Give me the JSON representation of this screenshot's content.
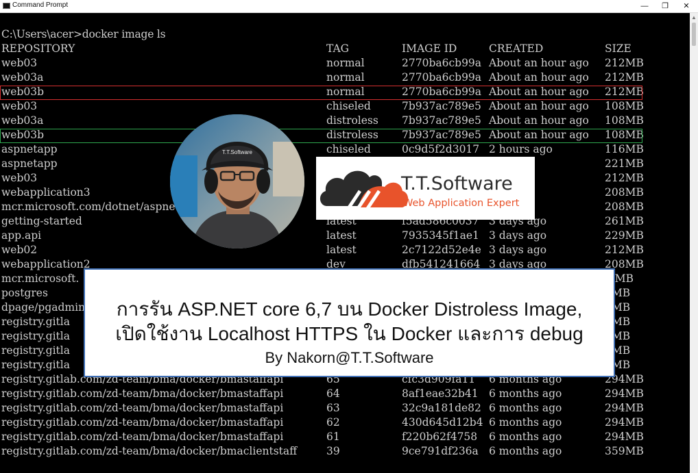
{
  "window": {
    "title": "Command Prompt",
    "minimize": "—",
    "maximize": "❐",
    "close": "✕"
  },
  "console": {
    "command_line": "C:\\Users\\acer>docker image ls",
    "headers": {
      "repository": "REPOSITORY",
      "tag": "TAG",
      "image_id": "IMAGE ID",
      "created": "CREATED",
      "size": "SIZE"
    },
    "rows": [
      {
        "repository": "web03",
        "tag": "normal",
        "image_id": "2770ba6cb99a",
        "created": "About an hour ago",
        "size": "212MB"
      },
      {
        "repository": "web03a",
        "tag": "normal",
        "image_id": "2770ba6cb99a",
        "created": "About an hour ago",
        "size": "212MB"
      },
      {
        "repository": "web03b",
        "tag": "normal",
        "image_id": "2770ba6cb99a",
        "created": "About an hour ago",
        "size": "212MB"
      },
      {
        "repository": "web03",
        "tag": "chiseled",
        "image_id": "7b937ac789e5",
        "created": "About an hour ago",
        "size": "108MB"
      },
      {
        "repository": "web03a",
        "tag": "distroless",
        "image_id": "7b937ac789e5",
        "created": "About an hour ago",
        "size": "108MB"
      },
      {
        "repository": "web03b",
        "tag": "distroless",
        "image_id": "7b937ac789e5",
        "created": "About an hour ago",
        "size": "108MB"
      },
      {
        "repository": "aspnetapp",
        "tag": "chiseled",
        "image_id": "0c9d5f2d3017",
        "created": "2 hours ago",
        "size": "116MB"
      },
      {
        "repository": "aspnetapp",
        "tag": "",
        "image_id": "",
        "created": "ago",
        "size": "221MB"
      },
      {
        "repository": "web03",
        "tag": "",
        "image_id": "",
        "created": "ago",
        "size": "212MB"
      },
      {
        "repository": "webapplication3",
        "tag": "",
        "image_id": "",
        "created": "ago",
        "size": "208MB"
      },
      {
        "repository": "mcr.microsoft.com/dotnet/aspne",
        "tag": "",
        "image_id": "",
        "created": "ago",
        "size": "208MB"
      },
      {
        "repository": "getting-started",
        "tag": "latest",
        "image_id": "f5ad586c0037",
        "created": "3 days ago",
        "size": "261MB"
      },
      {
        "repository": "app.api",
        "tag": "latest",
        "image_id": "7935345f1ae1",
        "created": "3 days ago",
        "size": "229MB"
      },
      {
        "repository": "web02",
        "tag": "latest",
        "image_id": "2c7122d52e4e",
        "created": "3 days ago",
        "size": "212MB"
      },
      {
        "repository": "webapplication2",
        "tag": "dev",
        "image_id": "dfb541241664",
        "created": "3 days ago",
        "size": "208MB"
      },
      {
        "repository": "mcr.microsoft.",
        "tag": "",
        "image_id": "",
        "created": "",
        "size": ".5MB"
      },
      {
        "repository": "postgres",
        "tag": "",
        "image_id": "",
        "created": "",
        "size": "9MB"
      },
      {
        "repository": "dpage/pgadmin4",
        "tag": "",
        "image_id": "",
        "created": "",
        "size": "0MB"
      },
      {
        "repository": "registry.gitla",
        "tag": "",
        "image_id": "",
        "created": "",
        "size": "2MB"
      },
      {
        "repository": "registry.gitla",
        "tag": "",
        "image_id": "",
        "created": "",
        "size": "4MB"
      },
      {
        "repository": "registry.gitla",
        "tag": "",
        "image_id": "",
        "created": "",
        "size": "4MB"
      },
      {
        "repository": "registry.gitla",
        "tag": "",
        "image_id": "",
        "created": "",
        "size": "4MB"
      },
      {
        "repository": "registry.gitlab.com/zd-team/bma/docker/bmastaffapi",
        "tag": "65",
        "image_id": "cfc3d909fa11",
        "created": "6 months ago",
        "size": "294MB"
      },
      {
        "repository": "registry.gitlab.com/zd-team/bma/docker/bmastaffapi",
        "tag": "64",
        "image_id": "8af1eae32b41",
        "created": "6 months ago",
        "size": "294MB"
      },
      {
        "repository": "registry.gitlab.com/zd-team/bma/docker/bmastaffapi",
        "tag": "63",
        "image_id": "32c9a181de82",
        "created": "6 months ago",
        "size": "294MB"
      },
      {
        "repository": "registry.gitlab.com/zd-team/bma/docker/bmastaffapi",
        "tag": "62",
        "image_id": "430d645d12b4",
        "created": "6 months ago",
        "size": "294MB"
      },
      {
        "repository": "registry.gitlab.com/zd-team/bma/docker/bmastaffapi",
        "tag": "61",
        "image_id": "f220b62f4758",
        "created": "6 months ago",
        "size": "294MB"
      },
      {
        "repository": "registry.gitlab.com/zd-team/bma/docker/bmaclientstaff",
        "tag": "39",
        "image_id": "9ce791df236a",
        "created": "6 months ago",
        "size": "359MB"
      }
    ],
    "highlight_colors": {
      "red": "#d63030",
      "green": "#2fa84f"
    }
  },
  "avatar": {
    "cap_text": "T.T.Software"
  },
  "logo": {
    "name": "T.T.Software",
    "tagline": "Web Application Expert",
    "color_dark": "#2b2b2b",
    "color_accent": "#e8532b"
  },
  "banner": {
    "line1": "การรัน ASP.NET core 6,7 บน Docker Distroless Image,",
    "line2": "เปิดใช้งาน Localhost HTTPS ใน Docker และการ debug",
    "byline": "By Nakorn@T.T.Software",
    "border_color": "#3f6fb5"
  }
}
